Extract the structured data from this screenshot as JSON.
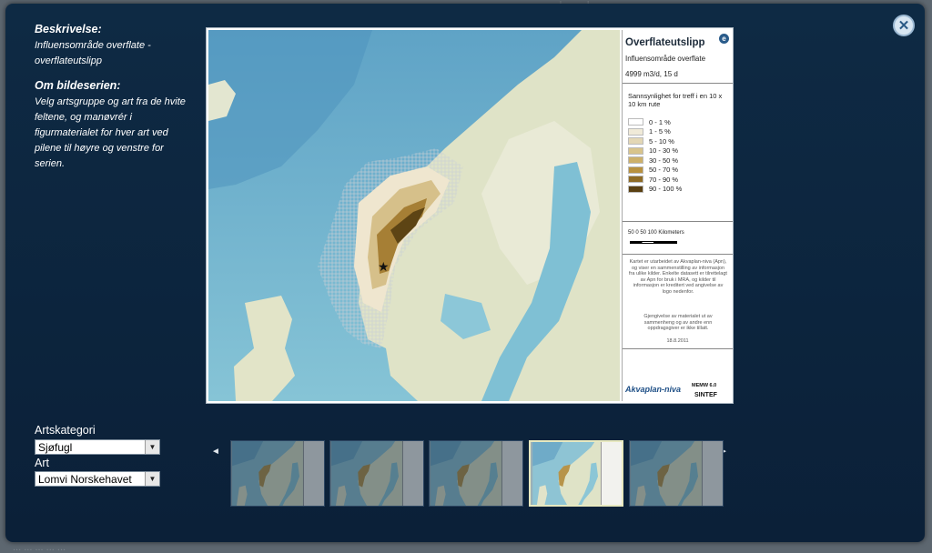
{
  "background": {
    "top_text": "... ... | ... ... | ...",
    "bottom_text": "... ... ... ... ..."
  },
  "info": {
    "desc_heading": "Beskrivelse:",
    "desc_text": "Influensområde overflate - overflateutslipp",
    "series_heading": "Om bildeserien:",
    "series_text": "Velg artsgruppe og art fra de hvite feltene, og manøvrér i figurmaterialet for hver art ved pilene til høyre og venstre for serien."
  },
  "legend": {
    "title": "Overflateutslipp",
    "subtitle": "Influensområde overflate",
    "rate": "4999 m3/d, 15 d",
    "head": "Sannsynlighet for treff i en 10 x 10 km rute",
    "classes": [
      {
        "label": "0 - 1 %",
        "color": "#ffffff"
      },
      {
        "label": "1 - 5 %",
        "color": "#f0ead8"
      },
      {
        "label": "5 - 10 %",
        "color": "#e3d7b5"
      },
      {
        "label": "10 - 30 %",
        "color": "#d8c48c"
      },
      {
        "label": "30 - 50 %",
        "color": "#cdb06a"
      },
      {
        "label": "50 - 70 %",
        "color": "#b8913f"
      },
      {
        "label": "70 - 90 %",
        "color": "#8f6b25"
      },
      {
        "label": "90 - 100 %",
        "color": "#5a4012"
      }
    ],
    "scale": "50  0   50  100   Kilometers",
    "note1": "Kartet er utarbeidet av Akvaplan-niva (Apn), og viser en sammenstilling av informasjon fra ulike kilder. Enkelte datasett er tilrettelagt av Apn for bruk i MRA, og kilder til informasjon er kreditert ved angivelse av logo nedenfor.",
    "note2": "Gjengivelse av materialet ut av sammenheng og av andre enn oppdragsgiver er ikke tillatt.",
    "date": "18.8.2011",
    "logo_akvaplan": "Akvaplan-niva",
    "logo_memw": "MEMW 6.0",
    "logo_sintef": "SINTEF"
  },
  "controls": {
    "category_label": "Artskategori",
    "category_value": "Sjøfugl",
    "species_label": "Art",
    "species_value": "Lomvi Norskehavet"
  },
  "carousel": {
    "prev": "◄",
    "next": "►",
    "thumbs": [
      {
        "name": "thumb-1",
        "active": false
      },
      {
        "name": "thumb-2",
        "active": false
      },
      {
        "name": "thumb-3",
        "active": false
      },
      {
        "name": "thumb-4",
        "active": true
      },
      {
        "name": "thumb-5",
        "active": false
      }
    ]
  },
  "colors": {
    "modal_bg": "#0e2a44",
    "sea": "#8ec8d8",
    "deep_sea": "#5ea3c4",
    "land": "#dde6c8",
    "accent": "#1e4f86"
  }
}
